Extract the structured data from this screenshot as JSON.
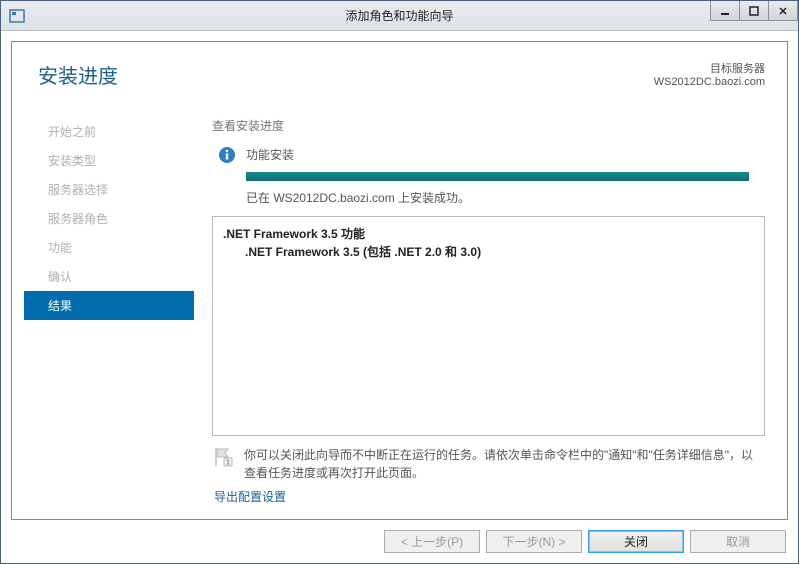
{
  "window": {
    "title": "添加角色和功能向导"
  },
  "header": {
    "page_title": "安装进度",
    "server_label": "目标服务器",
    "server_name": "WS2012DC.baozi.com"
  },
  "sidebar": {
    "items": [
      {
        "label": "开始之前",
        "active": false
      },
      {
        "label": "安装类型",
        "active": false
      },
      {
        "label": "服务器选择",
        "active": false
      },
      {
        "label": "服务器角色",
        "active": false
      },
      {
        "label": "功能",
        "active": false
      },
      {
        "label": "确认",
        "active": false
      },
      {
        "label": "结果",
        "active": true
      }
    ]
  },
  "main": {
    "section_label": "查看安装进度",
    "status_text": "功能安装",
    "install_message": "已在 WS2012DC.baozi.com 上安装成功。",
    "details": {
      "line1": ".NET Framework 3.5 功能",
      "line2": ".NET Framework 3.5 (包括 .NET 2.0 和 3.0)"
    },
    "note_text": "你可以关闭此向导而不中断正在运行的任务。请依次单击命令栏中的\"通知\"和\"任务详细信息\"，以查看任务进度或再次打开此页面。",
    "export_link": "导出配置设置"
  },
  "buttons": {
    "prev": "< 上一步(P)",
    "next": "下一步(N) >",
    "close": "关闭",
    "cancel": "取消"
  }
}
